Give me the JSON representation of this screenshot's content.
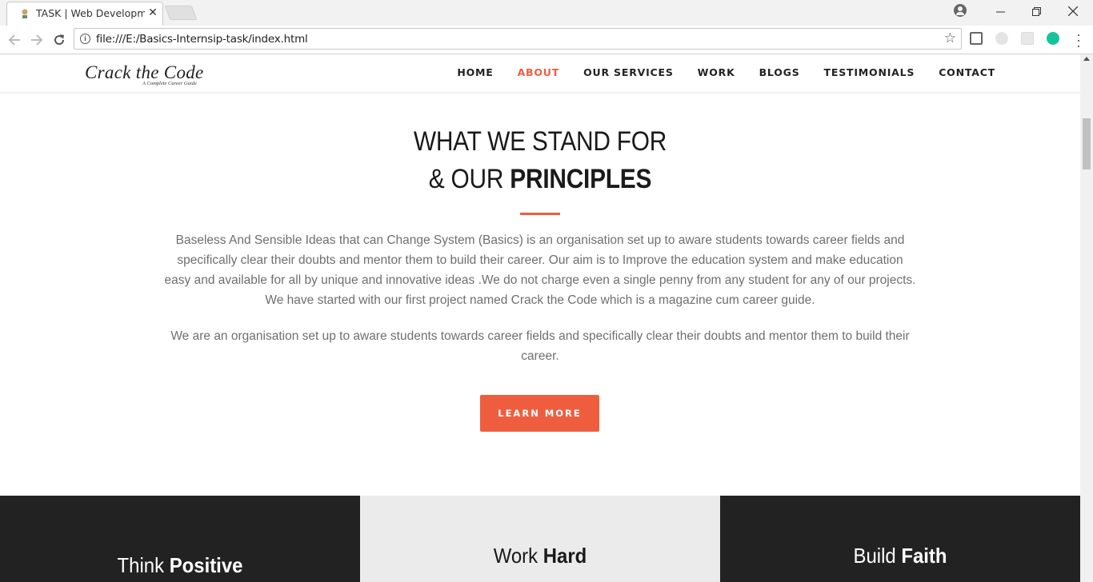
{
  "browser": {
    "tab_title": "TASK | Web Development",
    "url": "file:///E:/Basics-Internsip-task/index.html"
  },
  "site": {
    "logo_main": "Crack the Code",
    "logo_sub": "A Complete Career Guide",
    "nav": [
      {
        "label": "HOME",
        "active": false
      },
      {
        "label": "ABOUT",
        "active": true
      },
      {
        "label": "OUR SERVICES",
        "active": false
      },
      {
        "label": "WORK",
        "active": false
      },
      {
        "label": "BLOGS",
        "active": false
      },
      {
        "label": "TESTIMONIALS",
        "active": false
      },
      {
        "label": "CONTACT",
        "active": false
      }
    ]
  },
  "about": {
    "heading_line1": "WHAT WE STAND FOR",
    "heading_line2_prefix": "& OUR ",
    "heading_line2_bold": "PRINCIPLES",
    "paragraph1": "Baseless And Sensible Ideas that can Change System (Basics) is an organisation set up to aware students towards career fields and specifically clear their doubts and mentor them to build their career. Our aim is to Improve the education system and make education easy and available for all by unique and innovative ideas .We do not charge even a single penny from any student for any of our projects. We have started with our first project named Crack the Code which is a magazine cum career guide.",
    "paragraph2": "We are an organisation set up to aware students towards career fields and specifically clear their doubts and mentor them to build their career.",
    "button": "LEARN MORE"
  },
  "features": [
    {
      "light_word": "Think ",
      "bold_word": "Positive"
    },
    {
      "light_word": "Work ",
      "bold_word": "Hard"
    },
    {
      "light_word": "Build ",
      "bold_word": "Faith"
    }
  ],
  "colors": {
    "accent": "#ee5e3e",
    "dark_panel": "#222222",
    "light_panel": "#ebebeb"
  }
}
